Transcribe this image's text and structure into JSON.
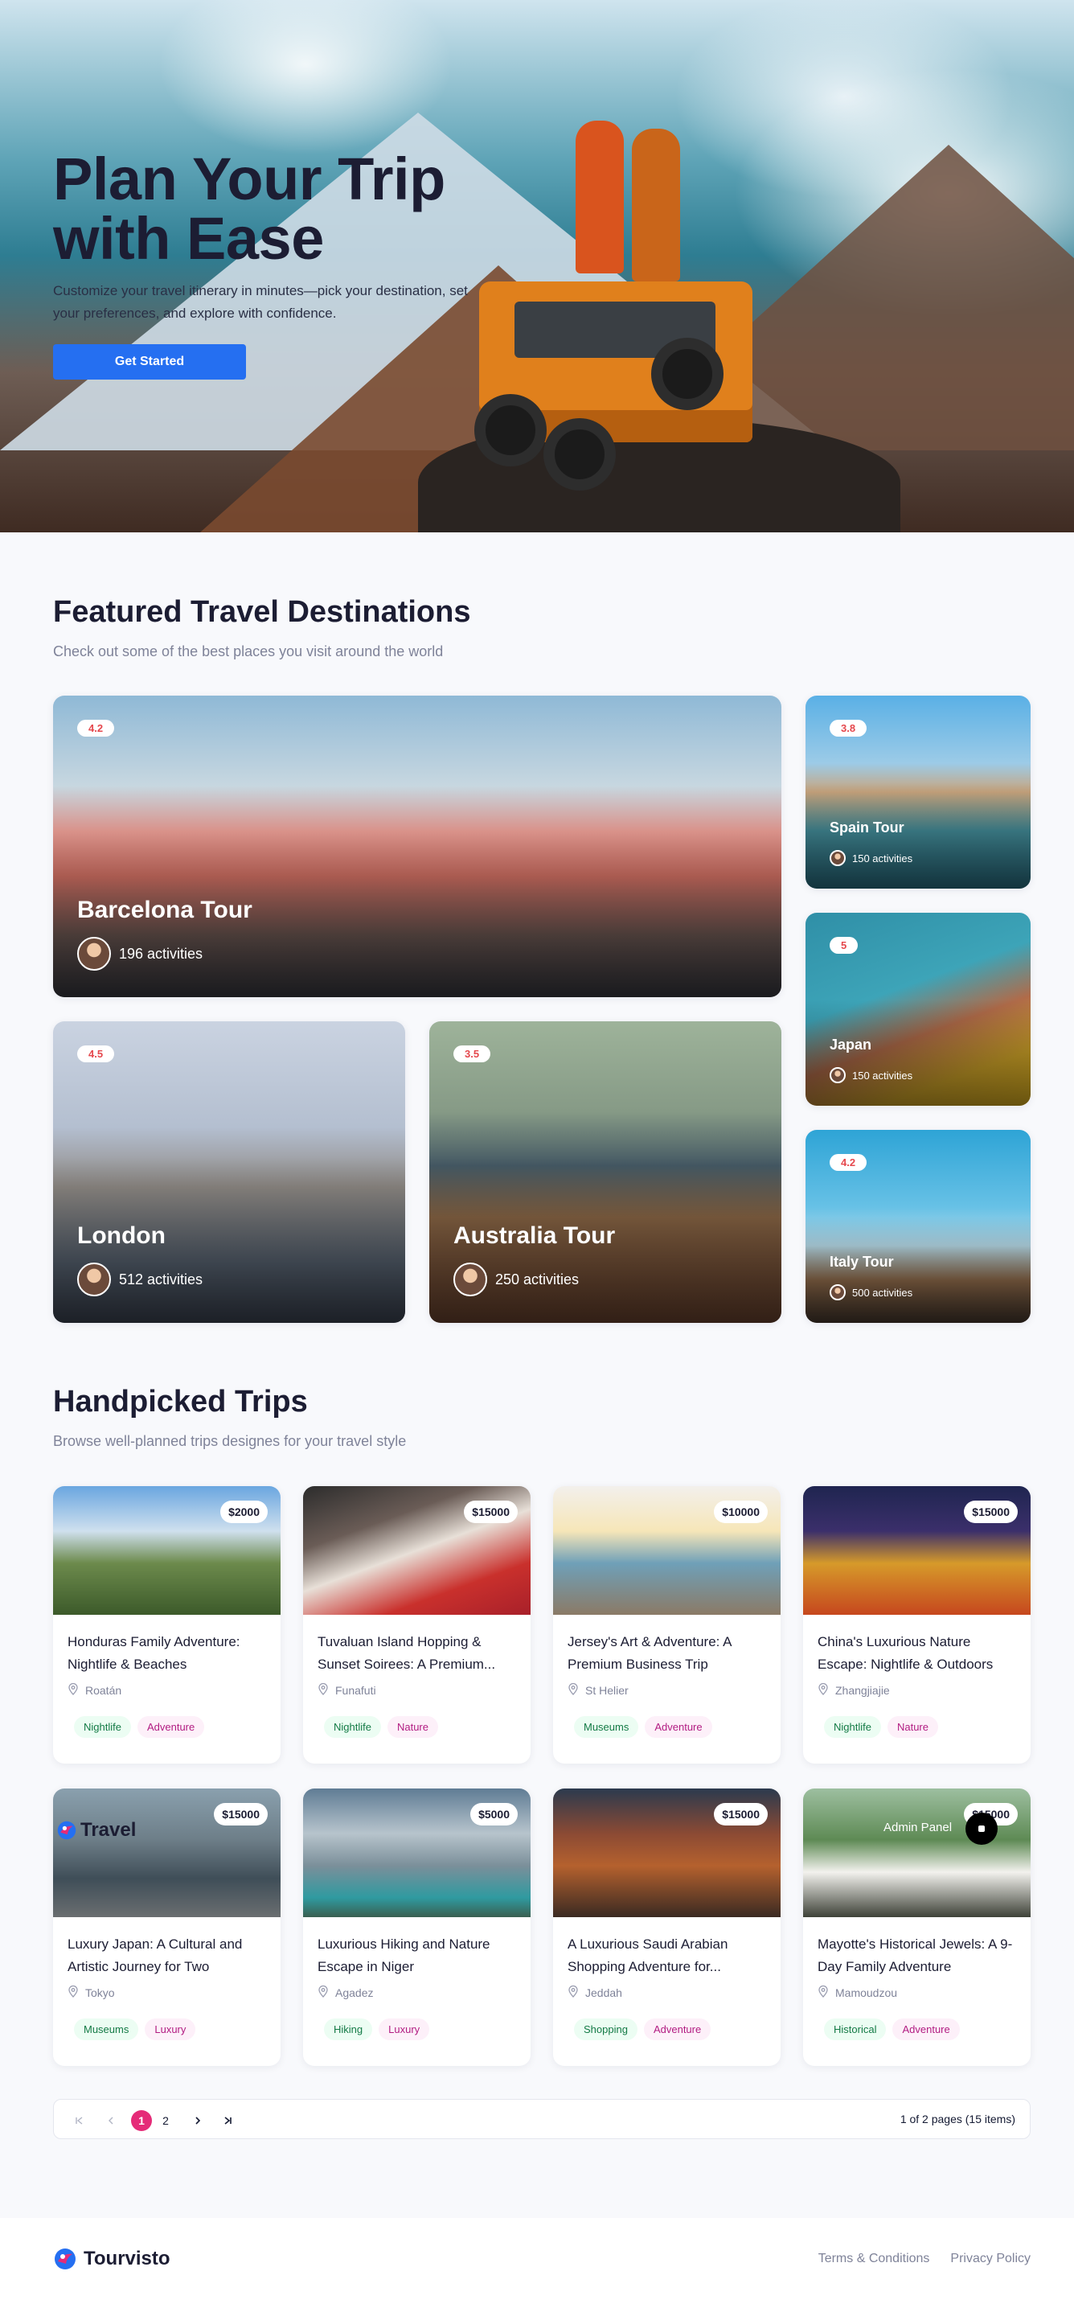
{
  "hero": {
    "title_line1": "Plan Your Trip",
    "title_line2": "with Ease",
    "subtitle": "Customize your travel itinerary in minutes—pick your destination, set your preferences, and explore with confidence.",
    "cta_label": "Get Started"
  },
  "featured": {
    "title": "Featured Travel Destinations",
    "subtitle": "Check out some of the best places you visit around the world",
    "destinations": [
      {
        "rating": "4.2",
        "name": "Barcelona Tour",
        "activities": "196 activities"
      },
      {
        "rating": "3.8",
        "name": "Spain Tour",
        "activities": "150 activities"
      },
      {
        "rating": "5",
        "name": "Japan",
        "activities": "150 activities"
      },
      {
        "rating": "4.5",
        "name": "London",
        "activities": "512 activities"
      },
      {
        "rating": "3.5",
        "name": "Australia Tour",
        "activities": "250 activities"
      },
      {
        "rating": "4.2",
        "name": "Italy Tour",
        "activities": "500 activities"
      }
    ]
  },
  "handpicked": {
    "title": "Handpicked Trips",
    "subtitle": "Browse well-planned trips designes for your travel style",
    "trips": [
      {
        "price": "$2000",
        "name": "Honduras Family Adventure: Nightlife & Beaches",
        "location": "Roatán",
        "tags": [
          "Nightlife",
          "Adventure"
        ]
      },
      {
        "price": "$15000",
        "name": "Tuvaluan Island Hopping & Sunset Soirees: A Premium...",
        "location": "Funafuti",
        "tags": [
          "Nightlife",
          "Nature"
        ]
      },
      {
        "price": "$10000",
        "name": "Jersey's Art & Adventure: A Premium Business Trip",
        "location": "St Helier",
        "tags": [
          "Museums",
          "Adventure"
        ]
      },
      {
        "price": "$15000",
        "name": "China's Luxurious Nature Escape: Nightlife & Outdoors",
        "location": "Zhangjiajie",
        "tags": [
          "Nightlife",
          "Nature"
        ]
      },
      {
        "price": "$15000",
        "name": "Luxury Japan: A Cultural and Artistic Journey for Two",
        "location": "Tokyo",
        "tags": [
          "Museums",
          "Luxury"
        ]
      },
      {
        "price": "$5000",
        "name": "Luxurious Hiking and Nature Escape in Niger",
        "location": "Agadez",
        "tags": [
          "Hiking",
          "Luxury"
        ]
      },
      {
        "price": "$15000",
        "name": "A Luxurious Saudi Arabian Shopping Adventure for...",
        "location": "Jeddah",
        "tags": [
          "Shopping",
          "Adventure"
        ]
      },
      {
        "price": "$15000",
        "name": "Mayotte's Historical Jewels: A 9-Day Family Adventure",
        "location": "Mamoudzou",
        "tags": [
          "Historical",
          "Adventure"
        ]
      }
    ],
    "overlay_logo": "Travel",
    "overlay_admin": "Admin Panel"
  },
  "pagination": {
    "pages": [
      "1",
      "2"
    ],
    "current": "1",
    "info": "1 of 2 pages (15 items)"
  },
  "footer": {
    "brand": "Tourvisto",
    "links": [
      "Terms & Conditions",
      "Privacy Policy"
    ]
  },
  "colors": {
    "primary": "#256ff1",
    "rating_text": "#e5484d",
    "page_active": "#e52b78",
    "tag_green_bg": "#ecfdf3",
    "tag_pink_bg": "#fdf0f9"
  }
}
